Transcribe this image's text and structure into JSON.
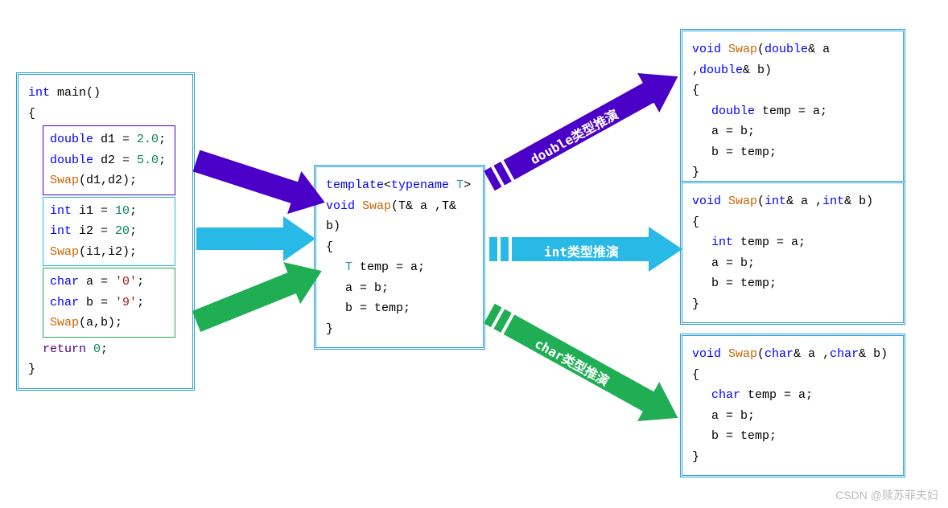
{
  "main_box": {
    "sig_int": "int",
    "sig_name": "main",
    "sig_paren": "()",
    "brace_open": "{",
    "brace_close": "}",
    "block1": {
      "l1": {
        "kw": "double",
        "var": " d1 ",
        "eq": "=",
        "val": " 2.0",
        "semi": ";"
      },
      "l2": {
        "kw": "double",
        "var": " d2 ",
        "eq": "=",
        "val": " 5.0",
        "semi": ";"
      },
      "l3": {
        "fn": "Swap",
        "args": "(d1,d2);"
      }
    },
    "block2": {
      "l1": {
        "kw": "int",
        "var": " i1 ",
        "eq": "=",
        "val": " 10",
        "semi": ";"
      },
      "l2": {
        "kw": "int",
        "var": " i2 ",
        "eq": "=",
        "val": " 20",
        "semi": ";"
      },
      "l3": {
        "fn": "Swap",
        "args": "(i1,i2);"
      }
    },
    "block3": {
      "l1": {
        "kw": "char",
        "var": " a ",
        "eq": "=",
        "val": " '0'",
        "semi": ";"
      },
      "l2": {
        "kw": "char",
        "var": " b ",
        "eq": "=",
        "val": " '9'",
        "semi": ";"
      },
      "l3": {
        "fn": "Swap",
        "args": "(a,b);"
      }
    },
    "ret": {
      "kw": "return",
      "val": " 0",
      "semi": ";"
    }
  },
  "template_box": {
    "l1": {
      "kw1": "template",
      "lt": "<",
      "kw2": "typename",
      "t": " T",
      "gt": ">"
    },
    "l2": {
      "kw": "void",
      "fn": " Swap",
      "args": "(T& a ,T& b)"
    },
    "brace_open": "{",
    "l3": {
      "t": "T",
      "rest": " temp = a;"
    },
    "l4": "a = b;",
    "l5": "b = temp;",
    "brace_close": "}"
  },
  "double_box": {
    "l1": {
      "kw": "void",
      "fn": " Swap",
      "p": "(",
      "t1": "double",
      "a1": "& a ,",
      "t2": "double",
      "a2": "& b)"
    },
    "brace_open": "{",
    "l2": {
      "t": "double",
      "rest": " temp = a;"
    },
    "l3": "a = b;",
    "l4": "b = temp;",
    "brace_close": "}"
  },
  "int_box": {
    "l1": {
      "kw": "void",
      "fn": " Swap",
      "p": "(",
      "t1": "int",
      "a1": "& a ,",
      "t2": "int",
      "a2": "& b)"
    },
    "brace_open": "{",
    "l2": {
      "t": "int",
      "rest": " temp = a;"
    },
    "l3": "a = b;",
    "l4": "b = temp;",
    "brace_close": "}"
  },
  "char_box": {
    "l1": {
      "kw": "void",
      "fn": " Swap",
      "p": "(",
      "t1": "char",
      "a1": "& a ,",
      "t2": "char",
      "a2": "& b)"
    },
    "brace_open": "{",
    "l2": {
      "t": "char",
      "rest": " temp = a;"
    },
    "l3": "a = b;",
    "l4": "b = temp;",
    "brace_close": "}"
  },
  "arrows": {
    "double_label": "double类型推演",
    "int_label": "int类型推演",
    "char_label": "char类型推演"
  },
  "watermark": "CSDN @赎苏菲夫妇",
  "colors": {
    "purple": "#4b00c8",
    "cyan": "#29b9e6",
    "green": "#1fae54"
  }
}
